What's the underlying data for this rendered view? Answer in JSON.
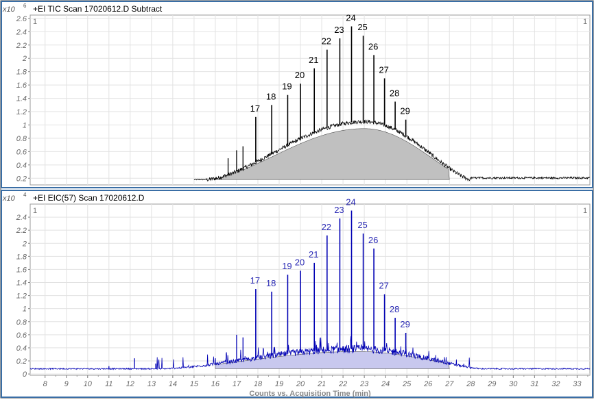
{
  "chart_data": [
    {
      "type": "line",
      "title": "+EI TIC Scan 17020612.D  Subtract",
      "multiplier": "x10",
      "exponent": "6",
      "corner_left": "1",
      "corner_right": "1",
      "xlim": [
        7.3,
        33.6
      ],
      "ylim": [
        0.1,
        2.65
      ],
      "yticks": [
        0.2,
        0.4,
        0.6,
        0.8,
        1,
        1.2,
        1.4,
        1.6,
        1.8,
        2,
        2.2,
        2.4,
        2.6
      ],
      "ytick_labels": [
        "0.2",
        "0.4",
        "0.6",
        "0.8",
        "1",
        "1.2",
        "1.4",
        "1.6",
        "1.8",
        "2",
        "2.2",
        "2.4",
        "2.6"
      ],
      "line_color": "#000000",
      "fill_color": "#c0c0c0",
      "baseline": 0.18,
      "hump": {
        "start": 15.6,
        "peak_x": 23.0,
        "peak_y": 1.05,
        "end": 28.0,
        "tail_end": 33.6,
        "tail_y": 0.2
      },
      "filled_region": [
        16.0,
        27.0
      ],
      "series": [
        {
          "peaks": [
            {
              "x": 17.9,
              "y": 1.12,
              "label": "17"
            },
            {
              "x": 18.65,
              "y": 1.3,
              "label": "18"
            },
            {
              "x": 19.4,
              "y": 1.45,
              "label": "19"
            },
            {
              "x": 20.0,
              "y": 1.62,
              "label": "20"
            },
            {
              "x": 20.65,
              "y": 1.85,
              "label": "21"
            },
            {
              "x": 21.25,
              "y": 2.13,
              "label": "22"
            },
            {
              "x": 21.85,
              "y": 2.3,
              "label": "23"
            },
            {
              "x": 22.4,
              "y": 2.48,
              "label": "24"
            },
            {
              "x": 22.95,
              "y": 2.34,
              "label": "25"
            },
            {
              "x": 23.45,
              "y": 2.05,
              "label": "26"
            },
            {
              "x": 23.95,
              "y": 1.7,
              "label": "27"
            },
            {
              "x": 24.45,
              "y": 1.35,
              "label": "28"
            },
            {
              "x": 24.95,
              "y": 1.08,
              "label": "29"
            }
          ],
          "minor_peaks": [
            {
              "x": 16.6,
              "y": 0.5
            },
            {
              "x": 17.0,
              "y": 0.62
            },
            {
              "x": 17.3,
              "y": 0.68
            }
          ]
        }
      ]
    },
    {
      "type": "line",
      "title": "+EI EIC(57) Scan 17020612.D",
      "multiplier": "x10",
      "exponent": "4",
      "corner_left": "1",
      "corner_right": "1",
      "xlim": [
        7.3,
        33.6
      ],
      "ylim": [
        -0.02,
        2.6
      ],
      "yticks": [
        0,
        0.2,
        0.4,
        0.6,
        0.8,
        1,
        1.2,
        1.4,
        1.6,
        1.8,
        2,
        2.2,
        2.4
      ],
      "ytick_labels": [
        "0",
        "0.2",
        "0.4",
        "0.6",
        "0.8",
        "1",
        "1.2",
        "1.4",
        "1.6",
        "1.8",
        "2",
        "2.2",
        "2.4"
      ],
      "line_color": "#0000b4",
      "fill_color": "#c8c8ee",
      "label_color": "#2a2ab4",
      "baseline": 0.08,
      "hump": {
        "start": 13.5,
        "peak_x": 22.7,
        "peak_y": 0.38,
        "end": 28.5,
        "tail_end": 33.6,
        "tail_y": 0.05
      },
      "filled_region": [
        16.0,
        27.0
      ],
      "xticks": [
        8,
        9,
        10,
        11,
        12,
        13,
        14,
        15,
        16,
        17,
        18,
        19,
        20,
        21,
        22,
        23,
        24,
        25,
        26,
        27,
        28,
        29,
        30,
        31,
        32,
        33
      ],
      "xtick_labels": [
        "8",
        "9",
        "10",
        "11",
        "12",
        "13",
        "14",
        "15",
        "16",
        "17",
        "18",
        "19",
        "20",
        "21",
        "22",
        "23",
        "24",
        "25",
        "26",
        "27",
        "28",
        "29",
        "30",
        "31",
        "32",
        "33"
      ],
      "xlabel": "Counts vs. Acquisition Time (min)",
      "series": [
        {
          "peaks": [
            {
              "x": 17.9,
              "y": 1.3,
              "label": "17"
            },
            {
              "x": 18.65,
              "y": 1.26,
              "label": "18"
            },
            {
              "x": 19.4,
              "y": 1.52,
              "label": "19"
            },
            {
              "x": 20.0,
              "y": 1.58,
              "label": "20"
            },
            {
              "x": 20.65,
              "y": 1.7,
              "label": "21"
            },
            {
              "x": 21.25,
              "y": 2.12,
              "label": "22"
            },
            {
              "x": 21.85,
              "y": 2.38,
              "label": "23"
            },
            {
              "x": 22.4,
              "y": 2.5,
              "label": "24"
            },
            {
              "x": 22.95,
              "y": 2.15,
              "label": "25"
            },
            {
              "x": 23.45,
              "y": 1.92,
              "label": "26"
            },
            {
              "x": 23.95,
              "y": 1.22,
              "label": "27"
            },
            {
              "x": 24.45,
              "y": 0.86,
              "label": "28"
            },
            {
              "x": 24.95,
              "y": 0.63,
              "label": "29"
            }
          ],
          "minor_peaks": [
            {
              "x": 11.0,
              "y": 0.12
            },
            {
              "x": 12.2,
              "y": 0.24
            },
            {
              "x": 13.2,
              "y": 0.16
            },
            {
              "x": 16.0,
              "y": 0.24
            },
            {
              "x": 17.0,
              "y": 0.6
            },
            {
              "x": 17.3,
              "y": 0.56
            }
          ]
        }
      ]
    }
  ]
}
